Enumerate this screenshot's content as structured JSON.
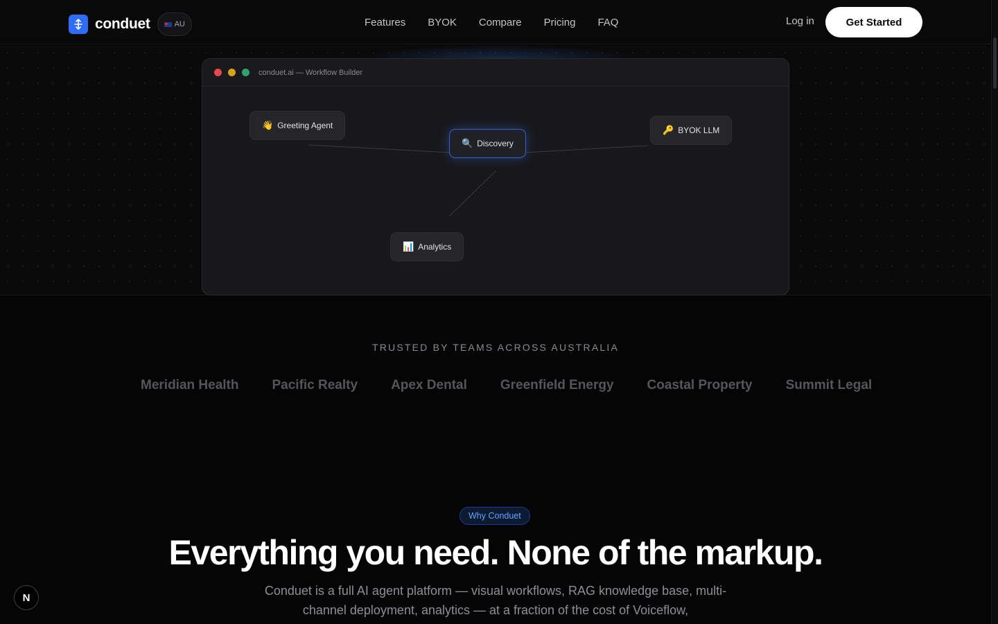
{
  "nav": {
    "brand": "conduet",
    "region": "AU",
    "links": [
      "Features",
      "BYOK",
      "Compare",
      "Pricing",
      "FAQ"
    ],
    "login": "Log in",
    "cta": "Get Started"
  },
  "window": {
    "title": "conduet.ai — Workflow Builder",
    "nodes": {
      "greeting": {
        "emoji": "👋",
        "label": "Greeting Agent"
      },
      "discovery": {
        "emoji": "🔍",
        "label": "Discovery"
      },
      "byok": {
        "emoji": "🔑",
        "label": "BYOK LLM"
      },
      "analytics": {
        "emoji": "📊",
        "label": "Analytics"
      }
    }
  },
  "trusted": {
    "label": "TRUSTED BY TEAMS ACROSS AUSTRALIA",
    "logos": [
      "Meridian Health",
      "Pacific Realty",
      "Apex Dental",
      "Greenfield Energy",
      "Coastal Property",
      "Summit Legal"
    ]
  },
  "why": {
    "pill": "Why Conduet",
    "headline": "Everything you need. None of the markup.",
    "sub": "Conduet is a full AI agent platform — visual workflows, RAG knowledge base, multi-channel deployment, analytics — at a fraction of the cost of Voiceflow,"
  },
  "badge": "N",
  "colors": {
    "accent": "#2f6df6",
    "background": "#050505",
    "pill_text": "#60a5fa"
  }
}
